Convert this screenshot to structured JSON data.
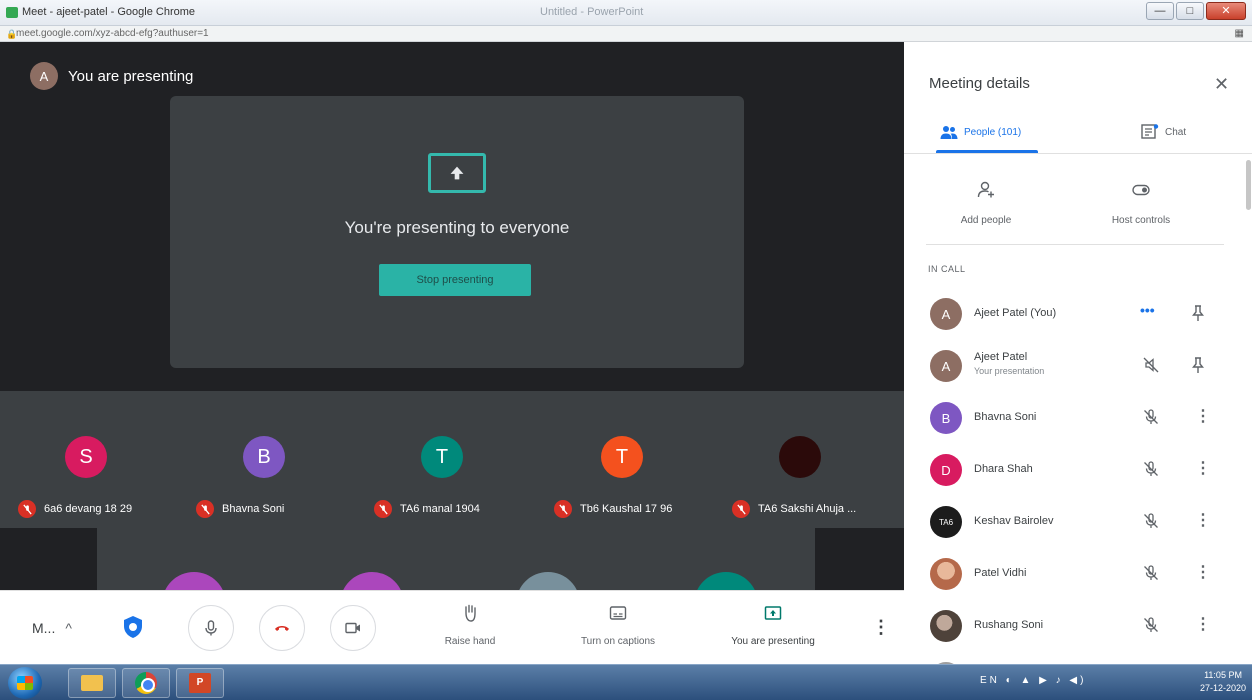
{
  "browser": {
    "title": "Meet - ajeet-patel - Google Chrome",
    "center_title": "Untitled - PowerPoint",
    "url": "meet.google.com/xyz-abcd-efg?authuser=1",
    "min_label": "—",
    "max_label": "□",
    "close_label": "✕"
  },
  "stage": {
    "presenting_avatar": "A",
    "presenting_label": "You are presenting",
    "present_message": "You're presenting to everyone",
    "stop_button": "Stop presenting"
  },
  "tiles": [
    {
      "initial": "S",
      "name": "6a6 devang 18 29",
      "color": "#d81b60"
    },
    {
      "initial": "B",
      "name": "Bhavna Soni",
      "color": "#7e57c2"
    },
    {
      "initial": "T",
      "name": "TA6 manal 1904",
      "color": "#00897b"
    },
    {
      "initial": "T",
      "name": "Tb6 Kaushal 17 96",
      "color": "#f4511e"
    },
    {
      "initial": "",
      "name": "TA6 Sakshi Ahuja ...",
      "color": "#2b0a0a"
    }
  ],
  "partial_tiles": [
    {
      "color": "#ab47bc"
    },
    {
      "color": "#ab47bc"
    },
    {
      "color": "#78909c"
    },
    {
      "color": "#00897b"
    }
  ],
  "controls": {
    "meeting_name": "M...",
    "caret": "^",
    "raise_hand": "Raise hand",
    "captions": "Turn on captions",
    "presenting": "You are presenting",
    "more": "⋮"
  },
  "panel": {
    "title": "Meeting details",
    "close": "✕",
    "people_tab": "People (101)",
    "chat_tab": "Chat",
    "add_people": "Add people",
    "host_controls": "Host controls",
    "in_call": "IN CALL",
    "people": [
      {
        "initial": "A",
        "name": "Ajeet Patel (You)",
        "sub": "",
        "color": "#8d6e63"
      },
      {
        "initial": "A",
        "name": "Ajeet Patel",
        "sub": "Your presentation",
        "color": "#8d6e63"
      },
      {
        "initial": "B",
        "name": "Bhavna Soni",
        "sub": "",
        "color": "#7e57c2"
      },
      {
        "initial": "D",
        "name": "Dhara Shah",
        "sub": "",
        "color": "#d81b60"
      },
      {
        "initial": "TA6",
        "name": "Keshav Bairolev",
        "sub": "",
        "color": "#1c1c1c"
      },
      {
        "initial": "",
        "name": "Patel Vidhi",
        "sub": "",
        "color": "#c98a6b"
      },
      {
        "initial": "",
        "name": "Rushang Soni",
        "sub": "",
        "color": "#6d5f55"
      }
    ]
  },
  "taskbar": {
    "ppt_label": "P",
    "tray": "EN ◐ ▲ ▶ ♪ ◀)",
    "time": "11:05 PM",
    "date": "27-12-2020"
  }
}
